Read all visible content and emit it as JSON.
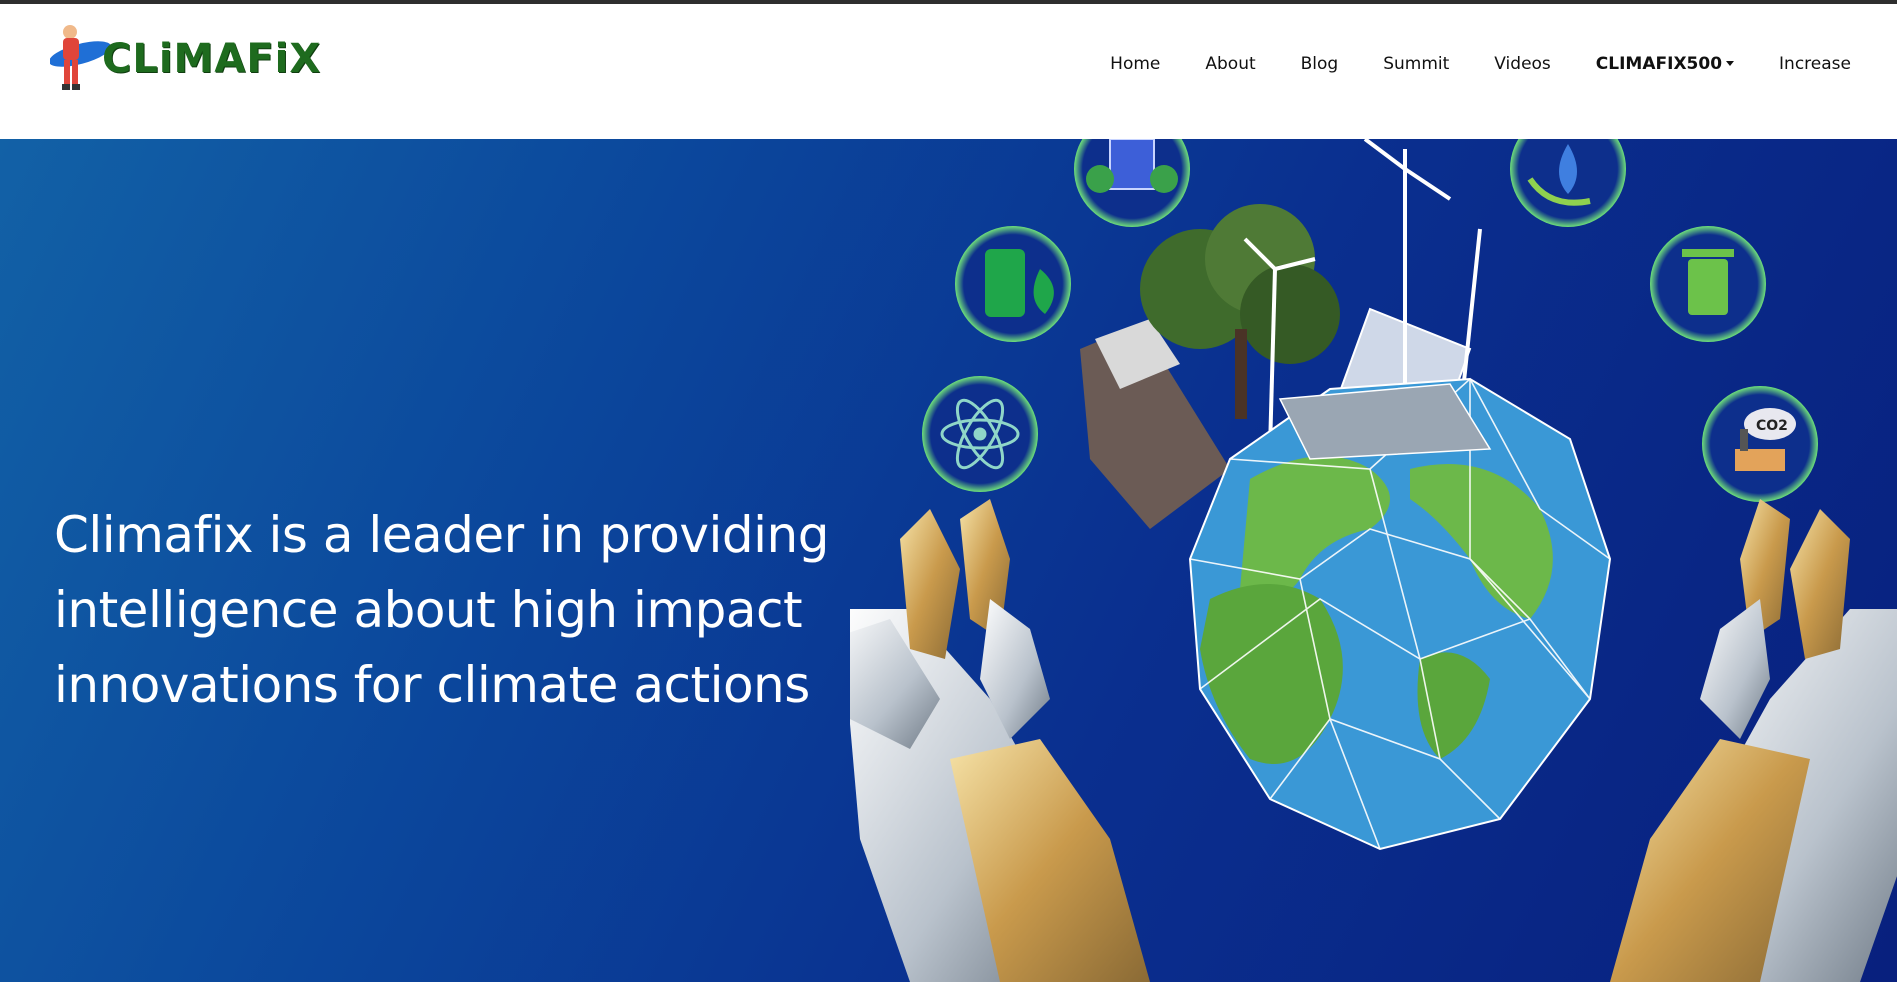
{
  "brand": {
    "logo_text": "CLiMAFiX"
  },
  "nav": {
    "items": [
      {
        "label": "Home"
      },
      {
        "label": "About"
      },
      {
        "label": "Blog"
      },
      {
        "label": "Summit"
      },
      {
        "label": "Videos"
      },
      {
        "label": "CLIMAFIX500"
      },
      {
        "label": "Increase"
      }
    ]
  },
  "hero": {
    "headline_lines": [
      "Climafix is a leader in providing",
      "intelligence about high impact",
      "innovations for climate actions"
    ],
    "icons": [
      "solar-recycle-icon",
      "water-cycle-icon",
      "green-battery-icon",
      "recycle-bin-icon",
      "atom-icon",
      "co2-factory-icon"
    ],
    "co2_label": "CO2"
  },
  "colors": {
    "hero_top": "#1261a6",
    "hero_bottom": "#08207e",
    "logo_green": "#1e6b1e"
  }
}
